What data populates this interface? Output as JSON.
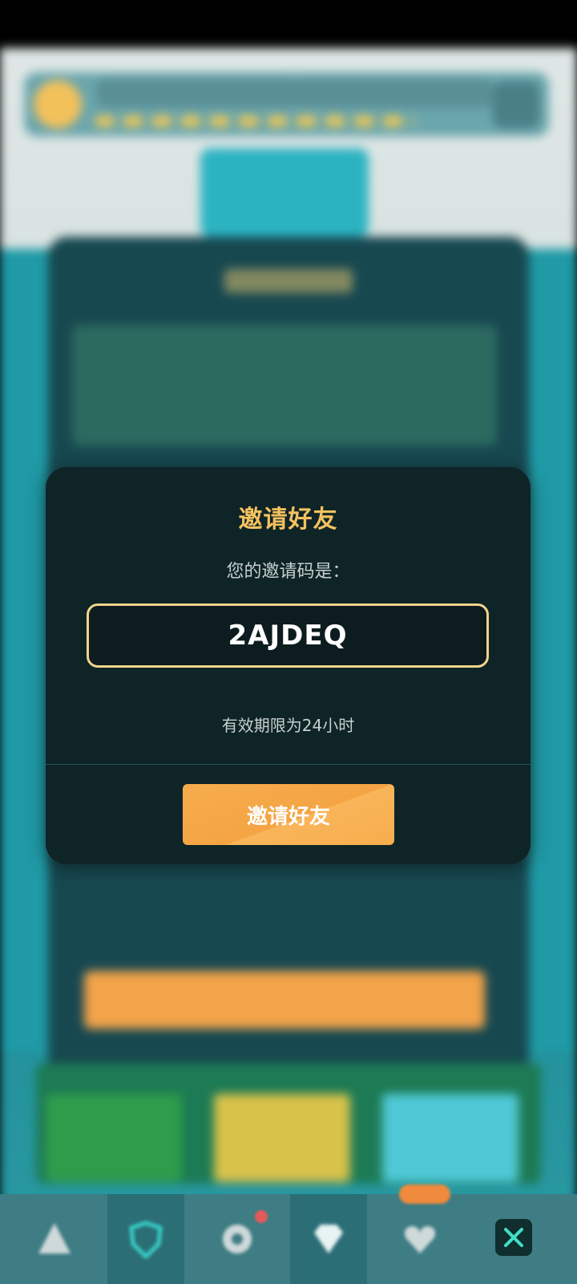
{
  "dialog": {
    "title": "邀请好友",
    "subtitle": "您的邀请码是：",
    "invite_code": "2AJDEQ",
    "validity": "有效期限为24小时",
    "button_label": "邀请好友"
  },
  "colors": {
    "title_gold": "#f5c25f",
    "code_border": "#f2d48a",
    "button_orange": "#f7ad4d",
    "dialog_bg": "#0f2426"
  },
  "bottom_nav": {
    "items": [
      {
        "icon": "triangle-icon"
      },
      {
        "icon": "shield-icon",
        "active": true
      },
      {
        "icon": "gear-icon",
        "badge": "dot"
      },
      {
        "icon": "diamond-icon",
        "active": true
      },
      {
        "icon": "heart-icon",
        "badge": "pill"
      }
    ],
    "close_icon": "close-icon"
  }
}
